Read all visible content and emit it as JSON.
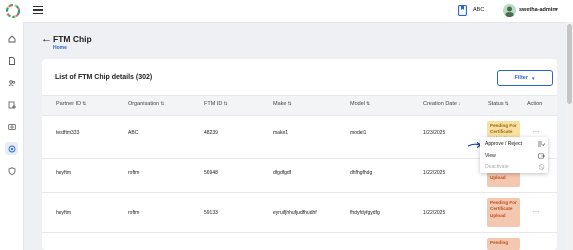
{
  "topbar": {
    "org": "ABC",
    "user": "swetha-admin"
  },
  "page": {
    "title": "FTM Chip",
    "breadcrumb": "Home"
  },
  "card": {
    "title": "List of FTM Chip details (302)",
    "filter_label": "Filter"
  },
  "table": {
    "columns": [
      "Partner ID",
      "Organisation",
      "FTM ID",
      "Make",
      "Model",
      "Creation Date",
      "Status",
      "Action"
    ],
    "rows": [
      {
        "partner": "testftm333",
        "org": "ABC",
        "ftm": "48239",
        "make": "make1",
        "model": "model1",
        "date": "1/23/2025",
        "status": "Pending For Certificate Upload"
      },
      {
        "partner": "heyftm",
        "org": "roftm",
        "ftm": "56948",
        "make": "dfgdfgdf",
        "model": "dhfhgfhdg",
        "date": "1/22/2025",
        "status": "Pending For Certificate Upload"
      },
      {
        "partner": "heyftm",
        "org": "roftm",
        "ftm": "59133",
        "make": "eyruifjhhufjudfhudhf",
        "model": "fhdyfdyfgydfg",
        "date": "1/22/2025",
        "status": "Pending For Certificate Upload"
      },
      {
        "partner": "",
        "org": "",
        "ftm": "",
        "make": "",
        "model": "",
        "date": "",
        "status": "Pending"
      }
    ]
  },
  "menu": {
    "items": [
      {
        "label": "Approve / Reject",
        "icon": "approve-list-icon"
      },
      {
        "label": "View",
        "icon": "view-icon"
      },
      {
        "label": "Deactivate",
        "icon": "deactivate-icon"
      }
    ]
  },
  "action_label": "...",
  "colors": {
    "accent": "#2b66c6",
    "status_bg": "#f4c7b0",
    "status_text": "#b8501f"
  }
}
